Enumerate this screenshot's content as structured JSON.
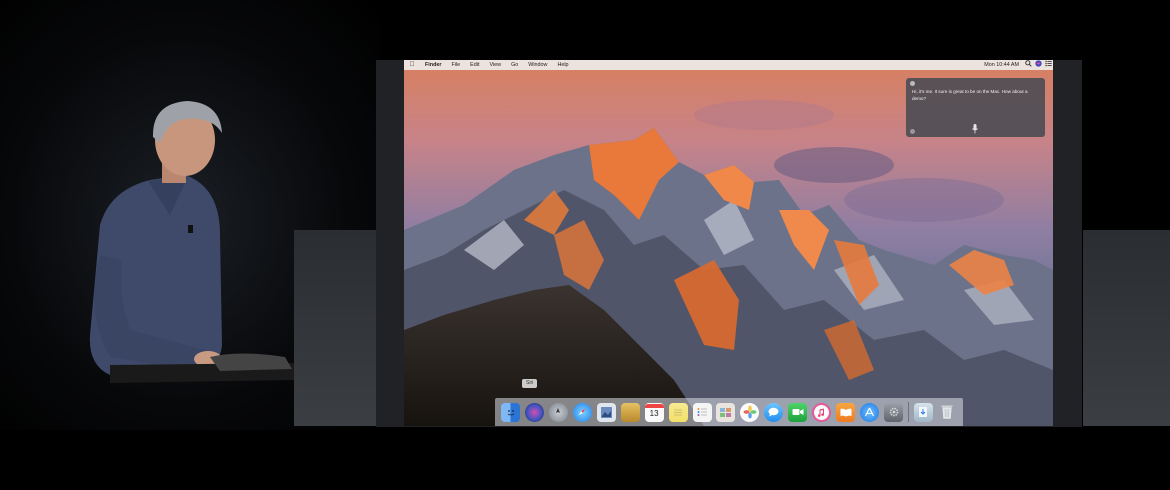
{
  "menubar": {
    "apple_symbol": "",
    "items": [
      "Finder",
      "File",
      "Edit",
      "View",
      "Go",
      "Window",
      "Help"
    ],
    "clock": "Mon 10:44 AM",
    "status_icons": [
      "search-icon",
      "siri-icon",
      "notification-center-icon"
    ]
  },
  "siri": {
    "message": "Hi, it's me. It sure is great to be on the Mac. How about a demo?"
  },
  "dock": {
    "tooltip": "Siri",
    "apps": [
      {
        "name": "finder-icon",
        "color": "#3d8bf2"
      },
      {
        "name": "siri-icon",
        "color": "#3a3f6e"
      },
      {
        "name": "launchpad-icon",
        "color": "#8a8f98"
      },
      {
        "name": "safari-icon",
        "color": "#2e8ff0"
      },
      {
        "name": "preview-icon",
        "color": "#5b7fb8"
      },
      {
        "name": "notes-folder-icon",
        "color": "#c39a3a"
      },
      {
        "name": "calendar-icon",
        "color": "#f6f6f6"
      },
      {
        "name": "notes-icon",
        "color": "#f3e38a"
      },
      {
        "name": "reminders-icon",
        "color": "#f2f2f2"
      },
      {
        "name": "photo-booth-icon",
        "color": "#e9e5de"
      },
      {
        "name": "photos-icon",
        "color": "#f1f1f1"
      },
      {
        "name": "messages-icon",
        "color": "#3aa2f4"
      },
      {
        "name": "facetime-icon",
        "color": "#2fb84f"
      },
      {
        "name": "itunes-icon",
        "color": "#f05b8f"
      },
      {
        "name": "ibooks-icon",
        "color": "#f18a2a"
      },
      {
        "name": "app-store-icon",
        "color": "#2f86e9"
      },
      {
        "name": "system-preferences-icon",
        "color": "#7d8088"
      },
      {
        "name": "downloads-icon",
        "color": "#b9c9d6"
      },
      {
        "name": "trash-icon",
        "color": "#c9ccd0"
      }
    ],
    "calendar_day": "13"
  }
}
